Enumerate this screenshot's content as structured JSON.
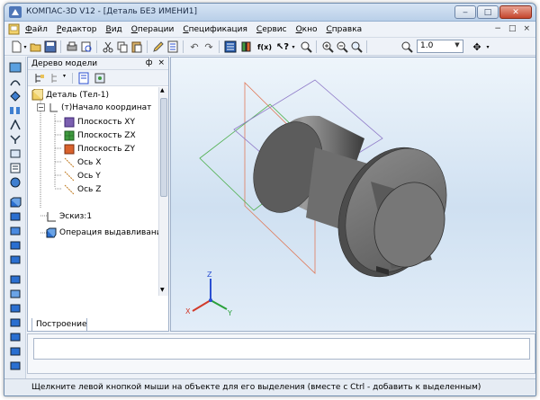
{
  "window": {
    "title": "КОМПАС-3D V12 - [Деталь БЕЗ ИМЕНИ1]",
    "controls": [
      "minimize",
      "maximize",
      "close"
    ]
  },
  "menubar": {
    "items": [
      {
        "label": "Файл",
        "underline": "Ф",
        "rest": "айл"
      },
      {
        "label": "Редактор",
        "underline": "Р",
        "rest": "едактор"
      },
      {
        "label": "Вид",
        "underline": "В",
        "rest": "ид"
      },
      {
        "label": "Операции",
        "underline": "О",
        "rest": "перации"
      },
      {
        "label": "Спецификация",
        "underline": "С",
        "rest": "пецификация"
      },
      {
        "label": "Сервис",
        "underline": "С",
        "rest": "ервис"
      },
      {
        "label": "Окно",
        "underline": "О",
        "rest": "кно"
      },
      {
        "label": "Справка",
        "underline": "С",
        "rest": "правка"
      }
    ],
    "mdi_controls": [
      "−",
      "□",
      "×"
    ]
  },
  "toolbar": {
    "zoom_value": "1.0",
    "fx_label": "f(x)"
  },
  "tree": {
    "title": "Дерево модели",
    "header_buttons": [
      "ф",
      "×"
    ],
    "items": [
      {
        "label": "Деталь (Тел-1)",
        "icon": "part-icon"
      },
      {
        "label": "(т)Начало координат",
        "icon": "origin-icon"
      },
      {
        "label": "Плоскость XY",
        "icon": "plane-xy-icon"
      },
      {
        "label": "Плоскость ZX",
        "icon": "plane-zx-icon"
      },
      {
        "label": "Плоскость ZY",
        "icon": "plane-zy-icon"
      },
      {
        "label": "Ось X",
        "icon": "axis-icon"
      },
      {
        "label": "Ось Y",
        "icon": "axis-icon"
      },
      {
        "label": "Ось Z",
        "icon": "axis-icon"
      },
      {
        "label": "Эскиз:1",
        "icon": "sketch-icon"
      },
      {
        "label": "Операция выдавливания",
        "icon": "extrude-icon"
      }
    ],
    "tab_label": "Построение"
  },
  "viewport": {
    "axis_labels": {
      "x": "X",
      "y": "Y",
      "z": "Z"
    }
  },
  "status": {
    "text": "Щелкните левой кнопкой мыши на объекте для его выделения (вместе с Ctrl - добавить к выделенным)"
  },
  "colors": {
    "plane_xy": "#7b5fb0",
    "plane_zx": "#3f9a3f",
    "plane_zy": "#d9622c",
    "axis_x": "#d23a2a",
    "axis_y": "#2aa03a",
    "axis_z": "#2a4fd2"
  }
}
